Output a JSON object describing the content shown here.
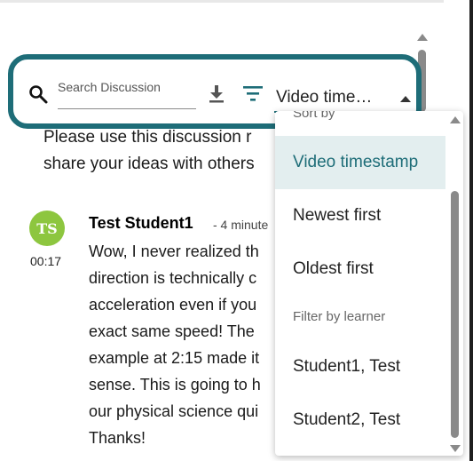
{
  "search": {
    "placeholder": "Search Discussion"
  },
  "toolbar": {
    "download_icon": "download-icon",
    "filter_icon": "filter-icon",
    "sort_value": "Video time…",
    "accent_color": "#1e6d78"
  },
  "intro": {
    "line1": "Please use this discussion r",
    "line2": "share your ideas with others"
  },
  "post": {
    "avatar_initials": "TS",
    "avatar_color": "#8dc63f",
    "timestamp": "00:17",
    "author": "Test Student1",
    "time_ago": "- 4 minute",
    "lines": [
      "Wow, I never realized th",
      "direction is technically c",
      "acceleration even if you",
      "exact same speed! The",
      "example at 2:15 made it",
      "sense. This is going to h",
      "our physical science qui",
      "Thanks!"
    ]
  },
  "dropdown": {
    "header": "Sort by",
    "options": [
      "Video timestamp",
      "Newest first",
      "Oldest first"
    ],
    "selected_index": 0,
    "group_label": "Filter by learner",
    "learners": [
      "Student1, Test",
      "Student2, Test"
    ]
  }
}
